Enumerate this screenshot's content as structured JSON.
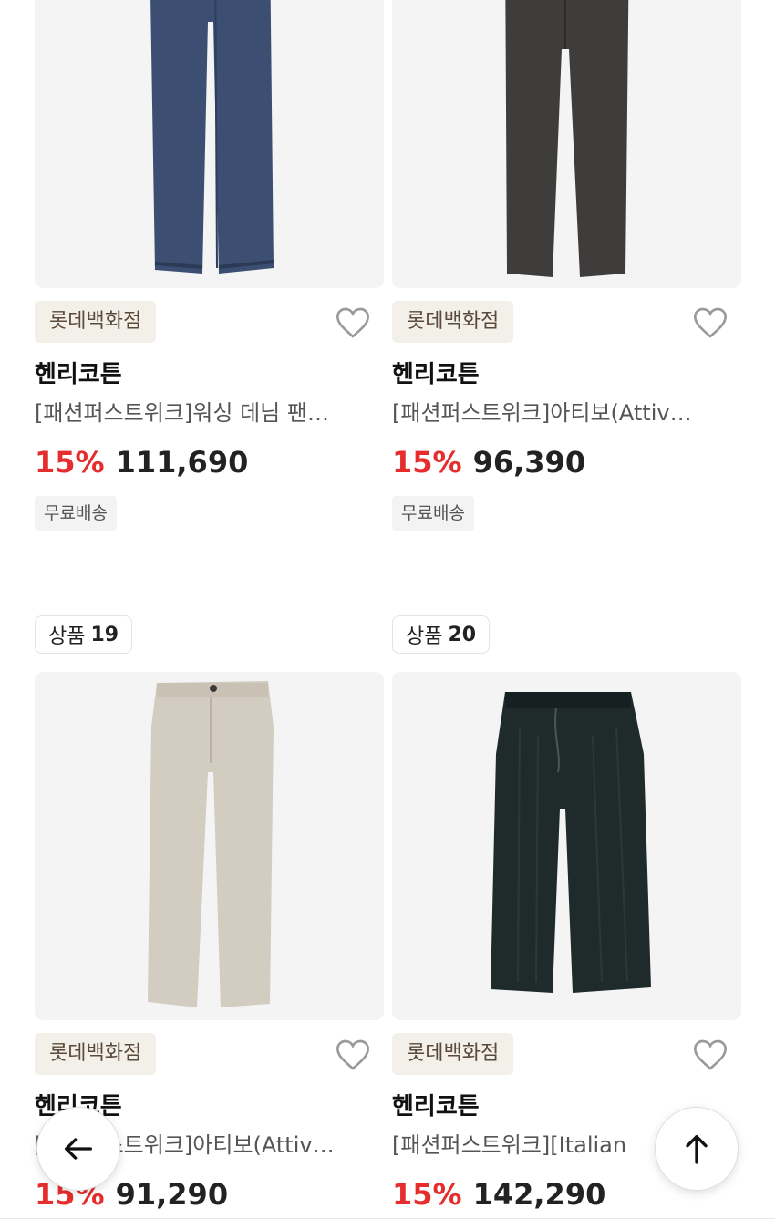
{
  "products": [
    {
      "rank_label": "",
      "rank_num": "",
      "store": "롯데백화점",
      "brand": "헨리코튼",
      "title": "[패션퍼스트위크]워싱 데님 팬…",
      "discount": "15%",
      "price": "111,690",
      "shipping": "무료배송",
      "image_color": "#3c4f72"
    },
    {
      "rank_label": "",
      "rank_num": "",
      "store": "롯데백화점",
      "brand": "헨리코튼",
      "title": "[패션퍼스트위크]아티보(Attiv…",
      "discount": "15%",
      "price": "96,390",
      "shipping": "무료배송",
      "image_color": "#3f3d3b"
    },
    {
      "rank_label": "상품",
      "rank_num": "19",
      "store": "롯데백화점",
      "brand": "헨리코튼",
      "title": "[패션퍼스트위크]아티보(Attiv…",
      "discount": "15%",
      "price": "91,290",
      "shipping": "",
      "image_color": "#d2ccc1"
    },
    {
      "rank_label": "상품",
      "rank_num": "20",
      "store": "롯데백화점",
      "brand": "헨리코튼",
      "title": "[패션퍼스트위크][Italian",
      "discount": "15%",
      "price": "142,290",
      "shipping": "",
      "image_color": "#1f2a2a"
    }
  ],
  "icons": {
    "wishlist": "heart-outline-icon",
    "back": "arrow-left-icon",
    "scroll_top": "arrow-up-icon"
  },
  "colors": {
    "discount": "#e52d2d",
    "store_tag_bg": "#f3efe9"
  }
}
